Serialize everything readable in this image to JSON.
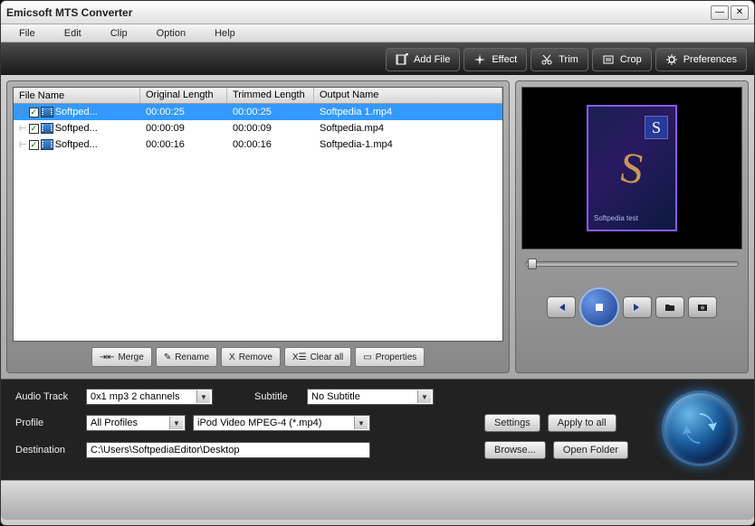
{
  "window": {
    "title": "Emicsoft MTS Converter"
  },
  "menubar": [
    "File",
    "Edit",
    "Clip",
    "Option",
    "Help"
  ],
  "toolbar": {
    "add_file": "Add File",
    "effect": "Effect",
    "trim": "Trim",
    "crop": "Crop",
    "preferences": "Preferences"
  },
  "list": {
    "headers": {
      "file": "File Name",
      "orig": "Original Length",
      "trim": "Trimmed Length",
      "out": "Output Name"
    },
    "rows": [
      {
        "file": "Softped...",
        "orig": "00:00:25",
        "trim": "00:00:25",
        "out": "Softpedia 1.mp4",
        "selected": true
      },
      {
        "file": "Softped...",
        "orig": "00:00:09",
        "trim": "00:00:09",
        "out": "Softpedia.mp4",
        "selected": false
      },
      {
        "file": "Softped...",
        "orig": "00:00:16",
        "trim": "00:00:16",
        "out": "Softpedia-1.mp4",
        "selected": false
      }
    ],
    "actions": {
      "merge": "Merge",
      "rename": "Rename",
      "remove": "Remove",
      "clear": "Clear all",
      "properties": "Properties"
    }
  },
  "preview": {
    "thumb_label": "Softpedia test"
  },
  "bottom": {
    "audio_track_label": "Audio Track",
    "audio_track_value": "0x1 mp3 2 channels",
    "subtitle_label": "Subtitle",
    "subtitle_value": "No Subtitle",
    "profile_label": "Profile",
    "profile_group": "All Profiles",
    "profile_value": "iPod Video MPEG-4 (*.mp4)",
    "settings": "Settings",
    "apply_all": "Apply to all",
    "destination_label": "Destination",
    "destination_value": "C:\\Users\\SoftpediaEditor\\Desktop",
    "browse": "Browse...",
    "open_folder": "Open Folder"
  }
}
